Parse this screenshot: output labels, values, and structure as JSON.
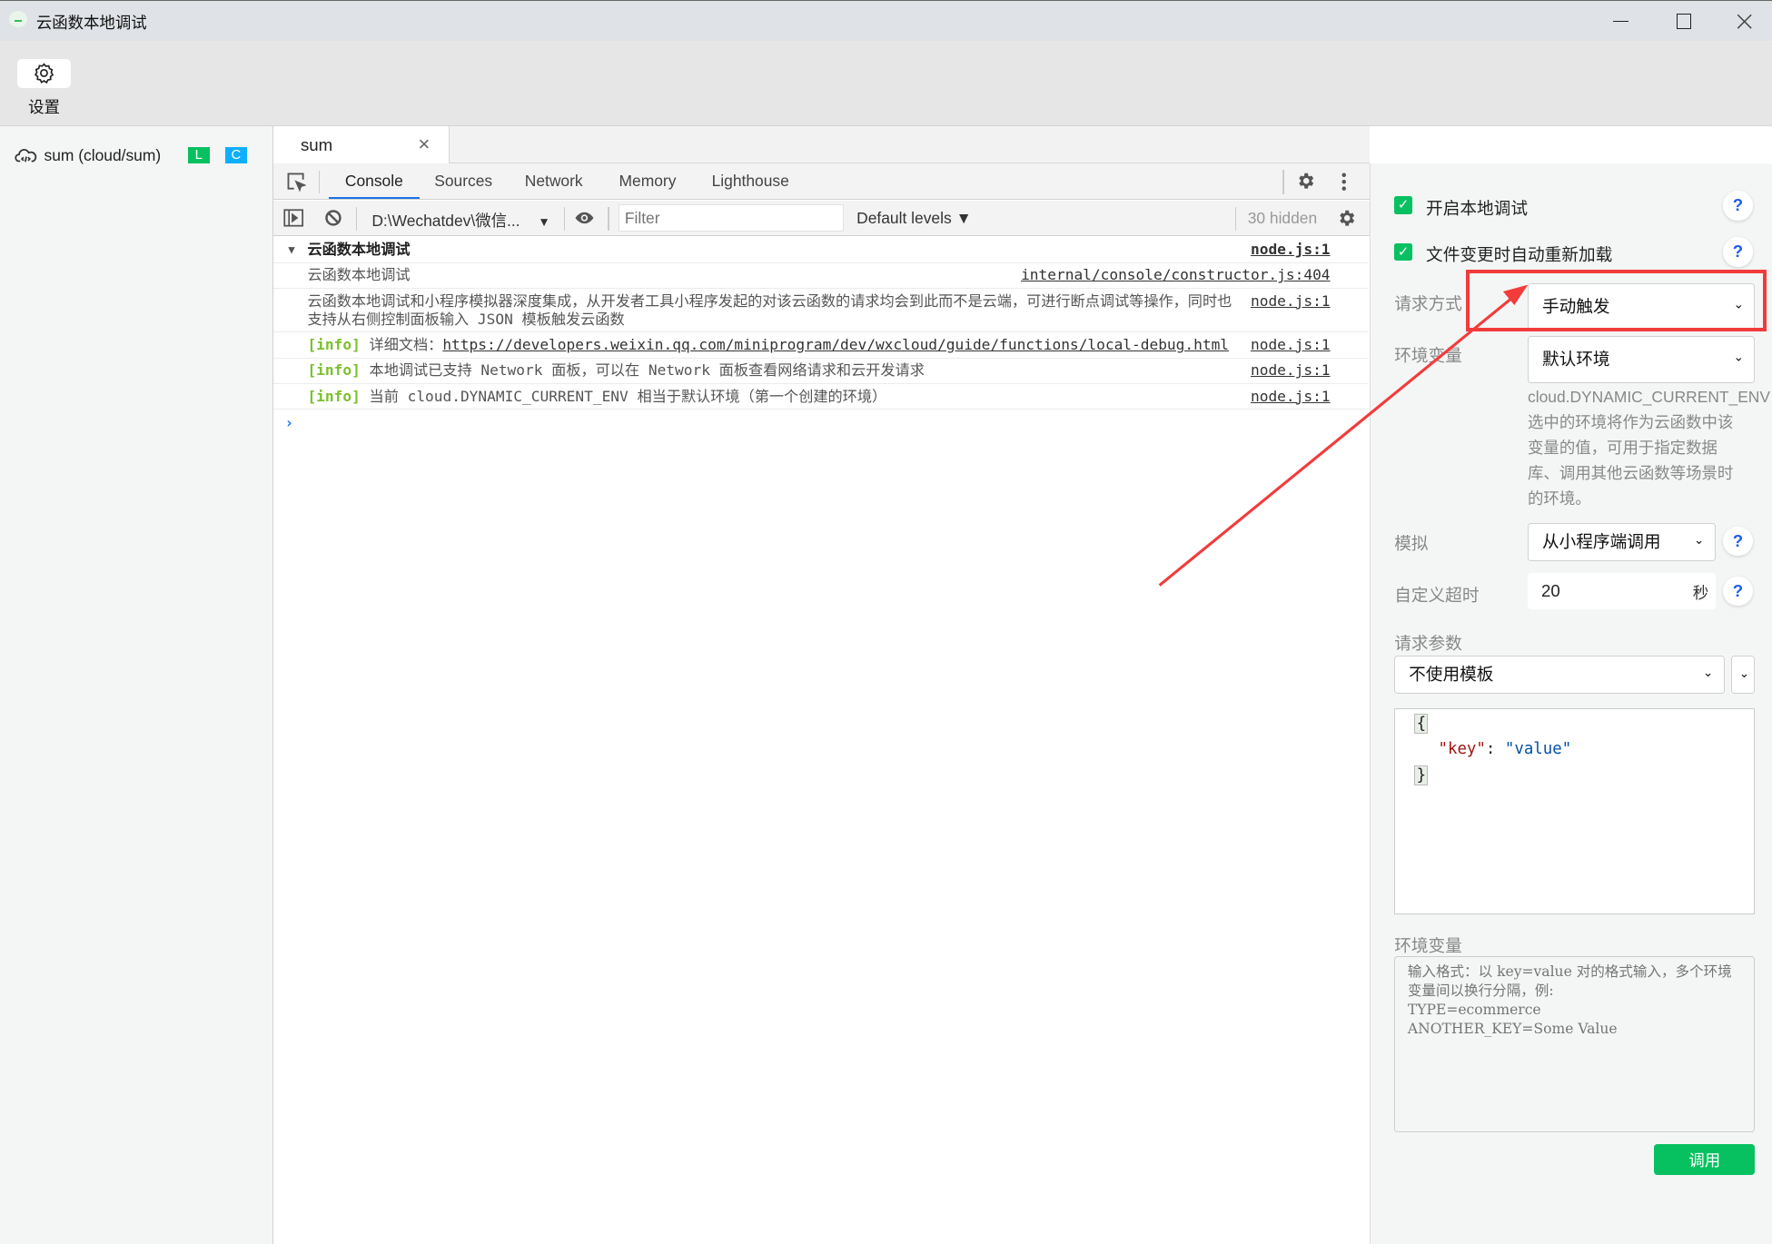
{
  "window": {
    "title": "云函数本地调试",
    "controls": {
      "minimize": "—",
      "maximize": "☐",
      "close": "✕"
    }
  },
  "toolbar": {
    "settings_label": "设置",
    "settings_icon": "gear-icon"
  },
  "sidebar": {
    "items": [
      {
        "label": "sum (cloud/sum)",
        "icon": "cloud-code-icon",
        "badges": [
          {
            "text": "L",
            "color": "#07c160"
          },
          {
            "text": "C",
            "color": "#10aeff"
          }
        ]
      }
    ]
  },
  "file_tabs": [
    {
      "label": "sum",
      "close": "×"
    }
  ],
  "devtools": {
    "tabs": [
      "Console",
      "Sources",
      "Network",
      "Memory",
      "Lighthouse"
    ],
    "active_tab": "Console",
    "console_toolbar": {
      "context": "D:\\Wechatdev\\微信...",
      "filter_placeholder": "Filter",
      "levels": "Default levels ▼",
      "hidden": "30 hidden"
    },
    "messages": {
      "group": {
        "text": "云函数本地调试",
        "source": "node.js:1"
      },
      "m1": {
        "text": "云函数本地调试",
        "source": "internal/console/constructor.js:404"
      },
      "m2": {
        "text": "云函数本地调试和小程序模拟器深度集成，从开发者工具小程序发起的对该云函数的请求均会到此而不是云端，可进行断点调试等操作，同时也支持从右侧控制面板输入 JSON 模板触发云函数",
        "source": "node.js:1"
      },
      "m3": {
        "tag": "[info]",
        "prefix": "详细文档：",
        "link": "https://developers.weixin.qq.com/miniprogram/dev/wxcloud/guide/functions/local-debug.html",
        "source": "node.js:1"
      },
      "m4": {
        "tag": "[info]",
        "text": "本地调试已支持 Network 面板，可以在 Network 面板查看网络请求和云开发请求",
        "source": "node.js:1"
      },
      "m5": {
        "tag": "[info]",
        "text": "当前 cloud.DYNAMIC_CURRENT_ENV 相当于默认环境（第一个创建的环境）",
        "source": "node.js:1"
      }
    },
    "prompt": "›"
  },
  "panel": {
    "enable_local_debug": {
      "label": "开启本地调试",
      "checked": true
    },
    "auto_reload": {
      "label": "文件变更时自动重新加载",
      "checked": true
    },
    "request_mode": {
      "label": "请求方式",
      "value": "手动触发"
    },
    "env": {
      "label": "环境变量",
      "value": "默认环境",
      "hint": [
        "cloud.DYNAMIC_CURRENT_ENV",
        "选中的环境将作为云函数中该",
        "变量的值，可用于指定数据",
        "库、调用其他云函数等场景时",
        "的环境。"
      ]
    },
    "simulate": {
      "label": "模拟",
      "value": "从小程序端调用"
    },
    "timeout": {
      "label": "自定义超时",
      "value": "20",
      "unit": "秒"
    },
    "params": {
      "label": "请求参数",
      "template": "不使用模板",
      "json": {
        "open": "{",
        "key": "\"key\"",
        "colon": ": ",
        "value": "\"value\"",
        "close": "}"
      }
    },
    "env_vars": {
      "label": "环境变量",
      "placeholder": "输入格式：以 key=value 对的格式输入，多个环境变量间以换行分隔，例:\nTYPE=ecommerce\nANOTHER_KEY=Some Value"
    },
    "call_button": "调用",
    "help": "?"
  },
  "annotation": {
    "color": "#f23b3b"
  }
}
